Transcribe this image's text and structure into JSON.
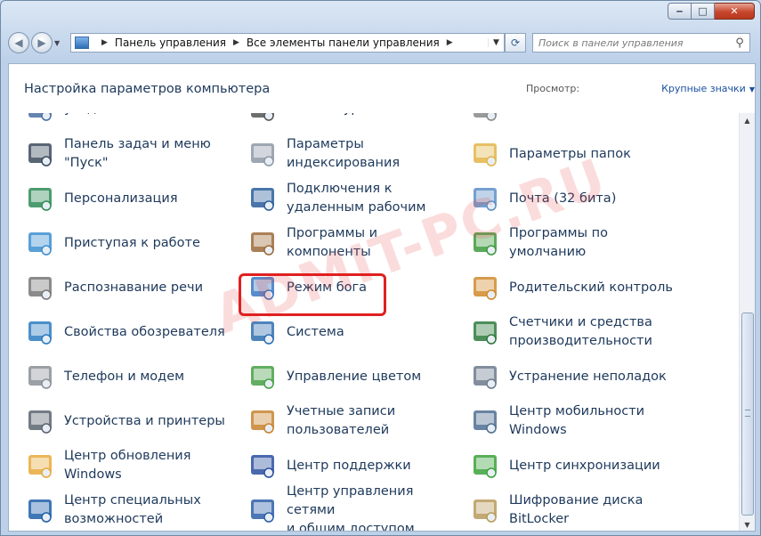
{
  "window": {
    "caption": {
      "min": "‒",
      "max": "□",
      "close": "✕"
    }
  },
  "navigation": {
    "breadcrumb": [
      "Панель управления",
      "Все элементы панели управления"
    ],
    "search_placeholder": "Поиск в панели управления",
    "refresh_icon": "refresh-icon",
    "search_icon": "search-icon"
  },
  "header": {
    "title": "Настройка параметров компьютера",
    "view_label": "Просмотр:",
    "view_value": "Крупные значки"
  },
  "items": {
    "col1": [
      {
        "label": "уведомлений",
        "icon": "notification-icon",
        "color": "#4a6fa5"
      },
      {
        "label": "Панель задач и меню\n\"Пуск\"",
        "icon": "taskbar-icon",
        "color": "#3b4a5c"
      },
      {
        "label": "Персонализация",
        "icon": "personalization-icon",
        "color": "#2e8b57"
      },
      {
        "label": "Приступая к работе",
        "icon": "getting-started-icon",
        "color": "#3c8fd0"
      },
      {
        "label": "Распознавание речи",
        "icon": "microphone-icon",
        "color": "#777777"
      },
      {
        "label": "Свойства обозревателя",
        "icon": "internet-options-icon",
        "color": "#2b7bbf"
      },
      {
        "label": "Телефон и модем",
        "icon": "phone-modem-icon",
        "color": "#8a8f96"
      },
      {
        "label": "Устройства и принтеры",
        "icon": "printer-icon",
        "color": "#5b6470"
      },
      {
        "label": "Центр обновления\nWindows",
        "icon": "windows-update-icon",
        "color": "#e7a93b"
      },
      {
        "label": "Центр специальных\nвозможностей",
        "icon": "accessibility-icon",
        "color": "#1f5fa8"
      }
    ],
    "col2": [
      {
        "label": "Клавиатура",
        "icon": "keyboard-icon",
        "color": "#555555"
      },
      {
        "label": "Параметры\nиндексирования",
        "icon": "indexing-icon",
        "color": "#8d98a6"
      },
      {
        "label": "Подключения к\nудаленным рабочим",
        "icon": "remote-desktop-icon",
        "color": "#2a5d9c"
      },
      {
        "label": "Программы и\nкомпоненты",
        "icon": "programs-icon",
        "color": "#9c6a3a"
      },
      {
        "label": "Режим бога",
        "icon": "god-mode-icon",
        "color": "#3a78c2"
      },
      {
        "label": "Система",
        "icon": "system-icon",
        "color": "#2f6fb0"
      },
      {
        "label": "Управление цветом",
        "icon": "color-management-icon",
        "color": "#47a047"
      },
      {
        "label": "Учетные записи\nпользователей",
        "icon": "user-accounts-icon",
        "color": "#c8822e"
      },
      {
        "label": "Центр поддержки",
        "icon": "action-center-flag-icon",
        "color": "#2a4fa0"
      },
      {
        "label": "Центр управления сетями\nи общим доступом",
        "icon": "network-icon",
        "color": "#2d5ea8"
      }
    ],
    "col3": [
      {
        "label": "Мышь",
        "icon": "mouse-icon",
        "color": "#888888"
      },
      {
        "label": "Параметры папок",
        "icon": "folder-options-icon",
        "color": "#e3b54a"
      },
      {
        "label": "Почта (32 бита)",
        "icon": "mail-icon",
        "color": "#5c8fc7"
      },
      {
        "label": "Программы по\nумолчанию",
        "icon": "default-programs-icon",
        "color": "#3e9a3e"
      },
      {
        "label": "Родительский контроль",
        "icon": "parental-controls-icon",
        "color": "#d08a2c"
      },
      {
        "label": "Счетчики и средства\nпроизводительности",
        "icon": "performance-icon",
        "color": "#2d7a3d"
      },
      {
        "label": "Устранение неполадок",
        "icon": "troubleshooting-icon",
        "color": "#6c7a8c"
      },
      {
        "label": "Центр мобильности\nWindows",
        "icon": "mobility-center-icon",
        "color": "#4f6f92"
      },
      {
        "label": "Центр синхронизации",
        "icon": "sync-center-icon",
        "color": "#3aa23a"
      },
      {
        "label": "Шифрование диска\nBitLocker",
        "icon": "bitlocker-icon",
        "color": "#b89a5a"
      }
    ]
  },
  "watermark": "ADMIT-PC.RU"
}
